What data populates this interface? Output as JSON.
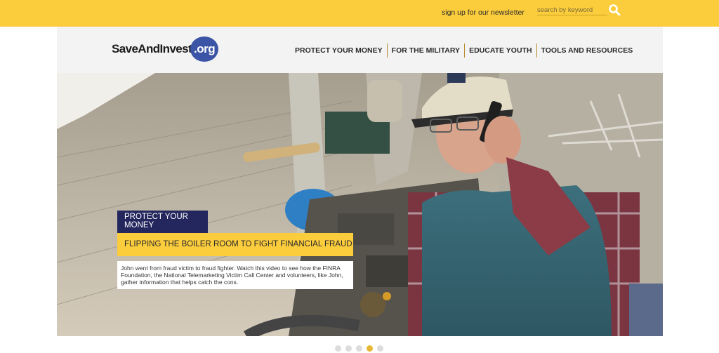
{
  "topbar": {
    "newsletter_label": "sign up for our newsletter",
    "search_placeholder": "search by keyword",
    "search_icon": "magnifier-icon",
    "color": "#fbcc3c"
  },
  "header": {
    "logo_text": "SaveAndInvest",
    "logo_org": ".org",
    "nav": [
      {
        "label": "PROTECT YOUR MONEY"
      },
      {
        "label": "FOR THE MILITARY"
      },
      {
        "label": "EDUCATE YOUTH"
      },
      {
        "label": "TOOLS AND RESOURCES"
      }
    ]
  },
  "hero": {
    "category": "PROTECT YOUR MONEY",
    "headline": "FLIPPING THE BOILER ROOM TO FIGHT FINANCIAL FRAUD",
    "summary": "John went from fraud victim to fraud fighter. Watch this video to see how the FINRA Foundation, the National Telemarketing Victim Call Center and volunteers, like John, gather information that helps catch the cons.",
    "colors": {
      "category_bg": "#24275e",
      "headline_bg": "#fbcc3c"
    }
  },
  "carousel": {
    "slide_count": 5,
    "active_index": 3
  }
}
